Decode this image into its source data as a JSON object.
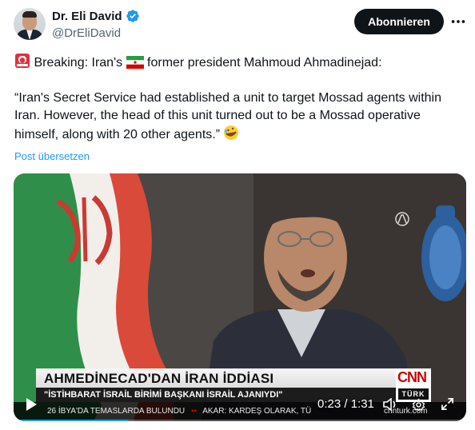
{
  "author": {
    "display_name": "Dr. Eli David",
    "handle": "@DrEliDavid",
    "verified": true
  },
  "header": {
    "subscribe_label": "Abonnieren"
  },
  "tweet": {
    "line1_prefix": "Breaking: Iran's",
    "line1_suffix": "former president Mahmoud Ahmadinejad:",
    "quote": "“Iran's Secret Service had established a unit to target Mossad agents within Iran. However, the head of this unit turned out to be a Mossad operative himself, along with 20 other agents.”",
    "emojis": [
      "siren-emoji",
      "iran-flag-emoji",
      "rofl-emoji"
    ],
    "translate_label": "Post übersetzen"
  },
  "video": {
    "headline": "AHMEDİNECAD'DAN İRAN İDDİASI",
    "subheadline": "\"İSTİHBARAT İSRAİL BİRİMİ BAŞKANI İSRAİL AJANIYDI\"",
    "channel_logo": "CNN",
    "channel_sub": "TÜRK",
    "crawl_1": "26 İBYA'DA TEMASLARDA BULUNDU",
    "crawl_2": "AKAR: KARDEŞ OLARAK, TÜ",
    "crawl_3": "cnnturk.com",
    "time_display": "0:23 / 1:31",
    "progress": 0.2527,
    "accent": "#1d9bf0"
  },
  "colors": {
    "subscribe_bg": "#0f1419",
    "link": "#1d9bf0",
    "verified": "#1d9bf0",
    "muted": "#536471"
  }
}
